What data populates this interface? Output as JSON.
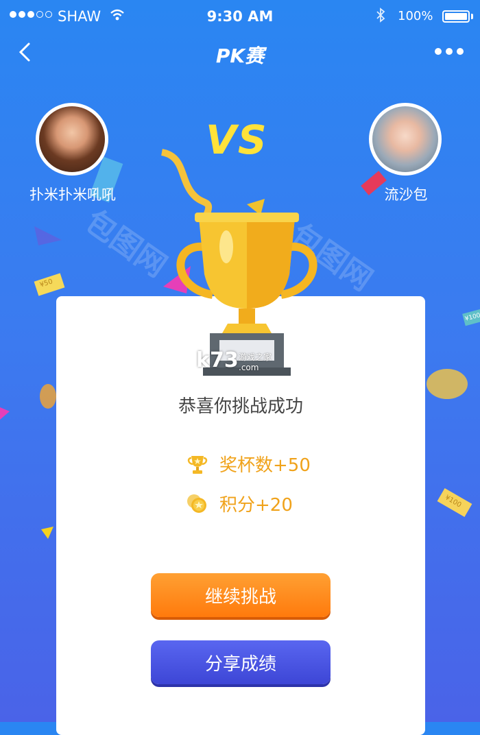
{
  "status_bar": {
    "carrier": "SHAW",
    "time": "9:30 AM",
    "battery": "100%",
    "signal_bars": 3,
    "signal_total": 5
  },
  "nav": {
    "title": "PK赛",
    "back_icon": "chevron-left-icon",
    "more_icon": "more-horizontal-icon"
  },
  "players": {
    "left": {
      "name": "扑米扑米吼吼"
    },
    "right": {
      "name": "流沙包"
    },
    "vs": "VS"
  },
  "result": {
    "message": "恭喜你挑战成功",
    "rewards": [
      {
        "icon": "trophy-icon",
        "text": "奖杯数+50"
      },
      {
        "icon": "coin-icon",
        "text": "积分+20"
      }
    ]
  },
  "buttons": {
    "continue": "继续挑战",
    "share": "分享成绩"
  },
  "confetti_tags": [
    "¥50",
    "¥100",
    "¥100"
  ],
  "watermark": {
    "site_name": "包图网",
    "brand": "k73",
    "brand_sub": "游戏之家",
    "brand_domain": ".com"
  },
  "colors": {
    "background_top": "#2a86f2",
    "background_bottom": "#4a63e8",
    "vs": "#ffe23a",
    "reward_text": "#f0a21a",
    "continue_button": "#ff8a1e",
    "share_button": "#4a55e3"
  }
}
